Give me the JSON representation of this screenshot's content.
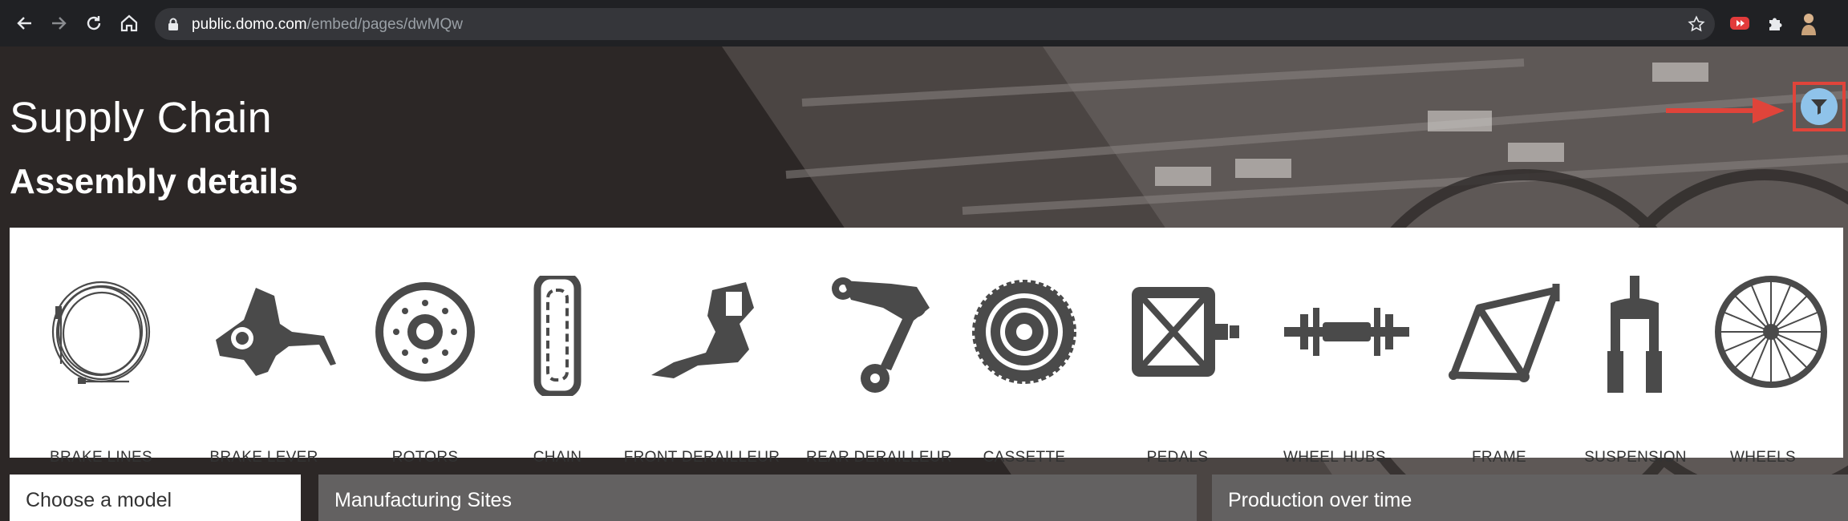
{
  "browser": {
    "url_host": "public.domo.com",
    "url_path": "/embed/pages/dwMQw"
  },
  "page": {
    "title": "Supply Chain",
    "subtitle": "Assembly details"
  },
  "parts": [
    {
      "label": "BRAKE LINES",
      "icon": "brake-lines-icon"
    },
    {
      "label": "BRAKE LEVER",
      "icon": "brake-lever-icon"
    },
    {
      "label": "ROTORS",
      "icon": "rotors-icon"
    },
    {
      "label": "CHAIN",
      "icon": "chain-icon"
    },
    {
      "label": "FRONT DERAILLEUR",
      "icon": "front-derailleur-icon"
    },
    {
      "label": "REAR DERAILLEUR",
      "icon": "rear-derailleur-icon"
    },
    {
      "label": "CASSETTE",
      "icon": "cassette-icon"
    },
    {
      "label": "PEDALS",
      "icon": "pedals-icon"
    },
    {
      "label": "WHEEL HUBS",
      "icon": "wheel-hubs-icon"
    },
    {
      "label": "FRAME",
      "icon": "frame-icon"
    },
    {
      "label": "SUSPENSION",
      "icon": "suspension-icon"
    },
    {
      "label": "WHEELS",
      "icon": "wheels-icon"
    }
  ],
  "cards": {
    "model": "Choose a model",
    "sites": "Manufacturing Sites",
    "production": "Production over time"
  },
  "colors": {
    "highlight": "#e0443a",
    "filter_button": "#8fc3ea",
    "icon": "#4a4a4a",
    "card_dark": "#636161"
  }
}
